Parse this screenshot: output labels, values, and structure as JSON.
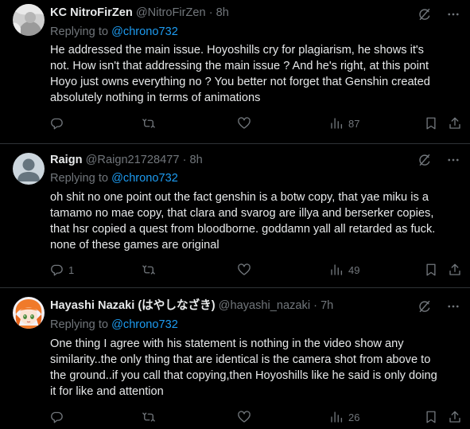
{
  "tweets": [
    {
      "name": "KC NitroFirZen",
      "handle": "@NitroFirZen",
      "time": "· 8h",
      "replying_label": "Replying to ",
      "replying_to": "@chrono732",
      "text": "He addressed the main issue. Hoyoshills cry for plagiarism, he shows it's\nnot. How isn't that addressing the main issue ? And he's right, at this point\nHoyo just owns everything no ? You better not forget that Genshin created\nabsolutely nothing in terms of animations",
      "replies": "",
      "retweets": "",
      "likes": "",
      "views": "87"
    },
    {
      "name": "Raign",
      "handle": "@Raign21728477",
      "time": "· 8h",
      "replying_label": "Replying to ",
      "replying_to": "@chrono732",
      "text": "oh shit no one point out the fact genshin is a botw copy, that yae miku is a\ntamamo no mae copy, that clara and svarog are illya and berserker copies,\nthat hsr copied a quest from bloodborne. goddamn yall all retarded as fuck.\nnone of these games are original",
      "replies": "1",
      "retweets": "",
      "likes": "",
      "views": "49"
    },
    {
      "name": "Hayashi Nazaki (はやしなざき)",
      "handle": "@hayashi_nazaki",
      "time": "· 7h",
      "replying_label": "Replying to ",
      "replying_to": "@chrono732",
      "text": "One thing I agree with his statement is nothing in the video show any\nsimilarity..the only thing that are identical is the camera shot from above to\nthe ground..if you call that copying,then Hoyoshills like he said is only doing\nit for like and attention",
      "replies": "",
      "retweets": "",
      "likes": "",
      "views": "26"
    }
  ],
  "icons": {
    "grok": "grok-icon",
    "more": "more-icon",
    "reply": "reply-icon",
    "retweet": "retweet-icon",
    "like": "like-icon",
    "views": "views-icon",
    "bookmark": "bookmark-icon",
    "share": "share-icon"
  },
  "colors": {
    "background": "#000000",
    "text": "#e7e9ea",
    "secondary": "#71767b",
    "link": "#1d9bf0",
    "divider": "#2f3336"
  }
}
